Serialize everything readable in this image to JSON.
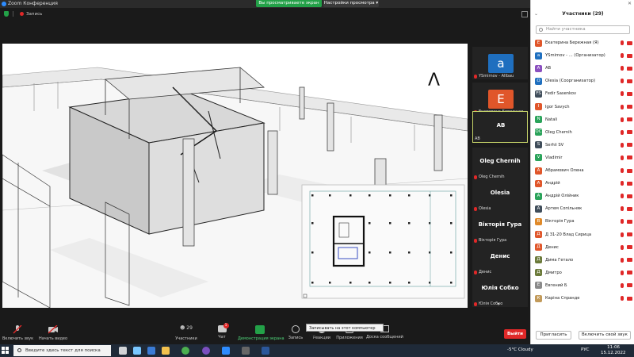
{
  "window": {
    "title": "Zoom Конференция",
    "share_banner": "Вы просматриваете экран AB",
    "view_options": "Настройки просмотра ▾"
  },
  "status": {
    "recording": "Запись"
  },
  "share": {
    "overlay_glyph": "Λ"
  },
  "tiles": [
    {
      "name": "YSmirnov - Allbau",
      "avatar": "a",
      "color": "#1f6fbf"
    },
    {
      "name": "Екатерина Бережная",
      "avatar": "E",
      "color": "#e0562a"
    },
    {
      "name": "AB",
      "center": "AB",
      "active": true
    },
    {
      "name": "Oleg Chernih",
      "center": "Oleg Chernih"
    },
    {
      "name": "Olesia",
      "center": "Olesia"
    },
    {
      "name": "Вікторія Гура",
      "center": "Вікторія Гура"
    },
    {
      "name": "Денис",
      "center": "Денис"
    },
    {
      "name": "Юлія Собко",
      "center": "Юлія Собко"
    }
  ],
  "toolbar": {
    "audio": "Включить звук",
    "video": "Начать видео",
    "participants": "Участники",
    "participants_count": "29",
    "chat": "Чат",
    "chat_badge": "1",
    "share": "Демонстрация экрана",
    "record": "Запись",
    "reactions": "Реакции",
    "apps": "Приложения",
    "whiteboard": "Доска сообщений",
    "leave": "Выйти",
    "record_tooltip": "Записывать на этот компьютер (Alt+R)"
  },
  "panel": {
    "title": "Участники (29)",
    "search_placeholder": "Найти участника",
    "invite": "Пригласить",
    "unmute_all": "Включить свой звук",
    "participants": [
      {
        "initial": "E",
        "name": "Екатерина Бережная (Я)",
        "color": "#e0562a"
      },
      {
        "initial": "a",
        "name": "YSmirnov - ... (Организатор)",
        "color": "#1f6fbf"
      },
      {
        "initial": "A",
        "name": "AB",
        "color": "#8a4fbf"
      },
      {
        "initial": "O",
        "name": "Olesia (Соорганизатор)",
        "color": "#1f6fbf"
      },
      {
        "initial": "FS",
        "name": "Fedir Sasenkov",
        "color": "#3f4d5a"
      },
      {
        "initial": "I",
        "name": "Igor Savych",
        "color": "#e0562a"
      },
      {
        "initial": "N",
        "name": "Natali",
        "color": "#2aa35a"
      },
      {
        "initial": "OC",
        "name": "Oleg Chernih",
        "color": "#2aa35a"
      },
      {
        "initial": "S",
        "name": "Serhii SV",
        "color": "#3f4d5a"
      },
      {
        "initial": "V",
        "name": "Vladimir",
        "color": "#2aa35a"
      },
      {
        "initial": "A",
        "name": "Абрамович Олена",
        "color": "#e0562a"
      },
      {
        "initial": "A",
        "name": "Андрій",
        "color": "#e0562a"
      },
      {
        "initial": "A",
        "name": "Андрій Олійник",
        "color": "#2aa35a"
      },
      {
        "initial": "A",
        "name": "Артем Сопільняк",
        "color": "#3f4d5a"
      },
      {
        "initial": "B",
        "name": "Вікторія Гура",
        "color": "#e08a2a"
      },
      {
        "initial": "Д",
        "name": "Д 31-20 Влад Сирицa",
        "color": "#e0562a"
      },
      {
        "initial": "Д",
        "name": "Денис",
        "color": "#e0562a"
      },
      {
        "initial": "Д",
        "name": "Дима Гетало",
        "color": "#6b7a3a"
      },
      {
        "initial": "Д",
        "name": "Дмитро",
        "color": "#6b7a3a"
      },
      {
        "initial": "Е",
        "name": "Евгений Б",
        "color": "#8a8a8a"
      },
      {
        "initial": "К",
        "name": "Каріна Спранде",
        "color": "#c29a5a"
      }
    ]
  },
  "taskbar": {
    "search": "Введите здесь текст для поиска",
    "weather": "-5°C  Cloudy",
    "lang": "РУС",
    "time": "11:06",
    "date": "15.12.2022"
  }
}
